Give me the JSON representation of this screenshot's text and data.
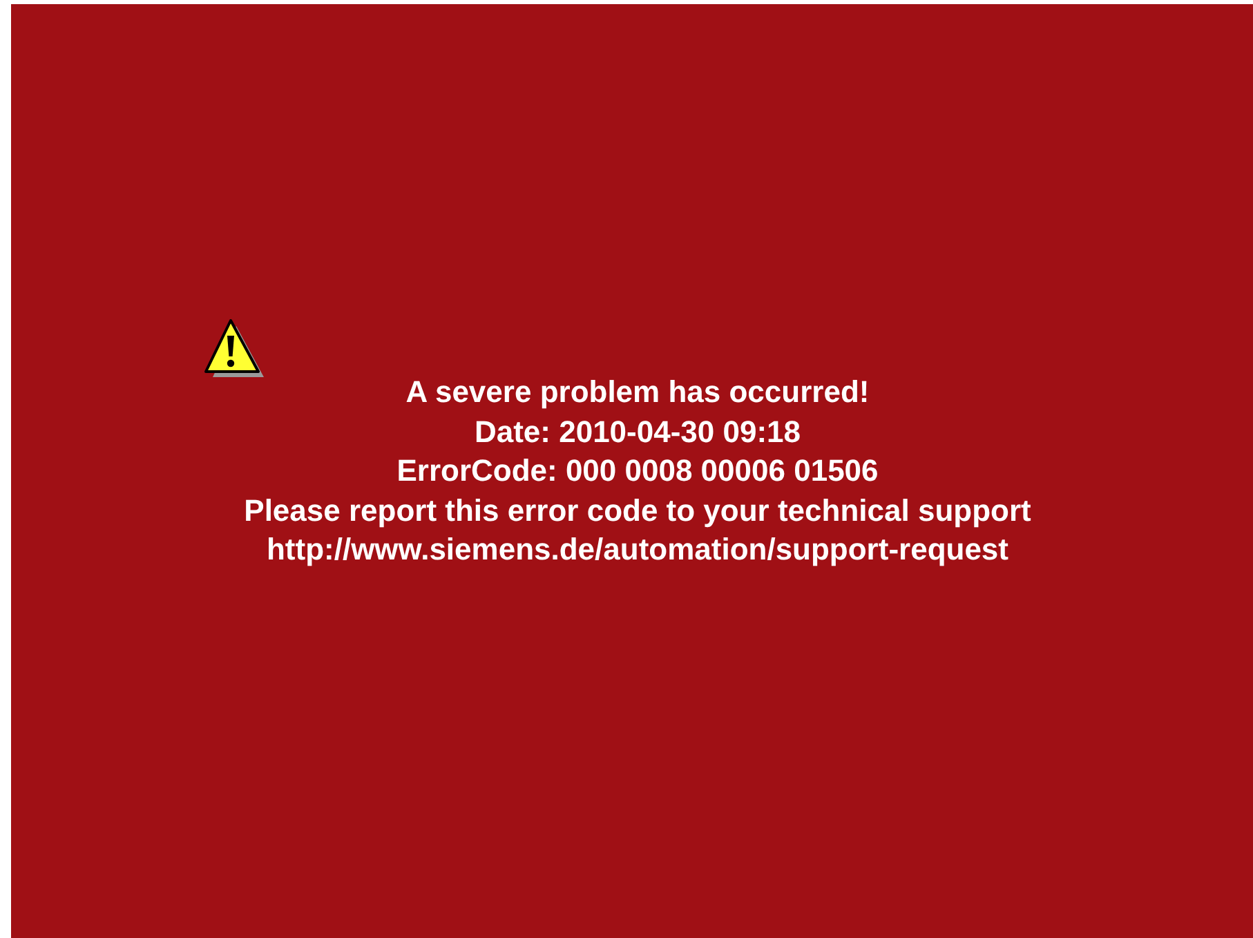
{
  "error_screen": {
    "lines": [
      "A severe problem has occurred!",
      "Date: 2010-04-30 09:18",
      "ErrorCode: 000 0008 00006 01506",
      "Please report this error code to your technical support",
      "http://www.siemens.de/automation/support-request"
    ]
  }
}
